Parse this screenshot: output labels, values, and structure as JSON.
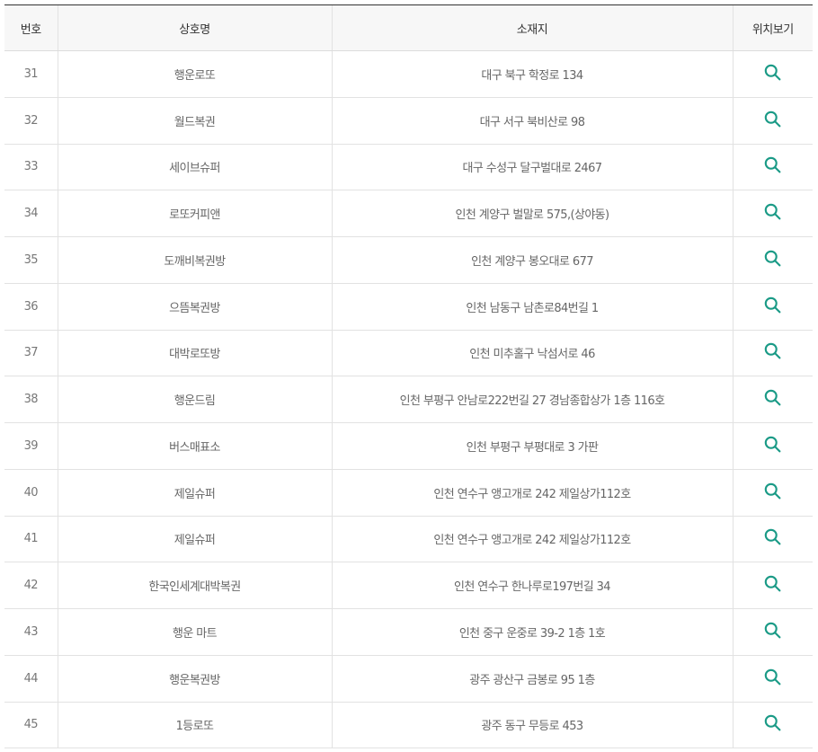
{
  "accent_color": "#1a9a86",
  "table": {
    "headers": [
      "번호",
      "상호명",
      "소재지",
      "위치보기"
    ],
    "rows": [
      {
        "no": "31",
        "name": "행운로또",
        "address": "대구 북구 학정로 134"
      },
      {
        "no": "32",
        "name": "월드복권",
        "address": "대구 서구 북비산로 98"
      },
      {
        "no": "33",
        "name": "세이브슈퍼",
        "address": "대구 수성구 달구벌대로 2467"
      },
      {
        "no": "34",
        "name": "로또커피앤",
        "address": "인천 계양구 벌말로 575,(상야동)"
      },
      {
        "no": "35",
        "name": "도깨비복권방",
        "address": "인천 계양구 봉오대로 677"
      },
      {
        "no": "36",
        "name": "으뜸복권방",
        "address": "인천 남동구 남촌로84번길 1"
      },
      {
        "no": "37",
        "name": "대박로또방",
        "address": "인천 미추홀구 낙섬서로 46"
      },
      {
        "no": "38",
        "name": "행운드림",
        "address": "인천 부평구 안남로222번길 27 경남종합상가 1층 116호"
      },
      {
        "no": "39",
        "name": "버스매표소",
        "address": "인천 부평구 부평대로 3 가판"
      },
      {
        "no": "40",
        "name": "제일슈퍼",
        "address": "인천 연수구 앵고개로 242 제일상가112호"
      },
      {
        "no": "41",
        "name": "제일슈퍼",
        "address": "인천 연수구 앵고개로 242 제일상가112호"
      },
      {
        "no": "42",
        "name": "한국인세계대박복권",
        "address": "인천 연수구 한나루로197번길 34"
      },
      {
        "no": "43",
        "name": "행운 마트",
        "address": "인천 중구 운중로 39-2 1층 1호"
      },
      {
        "no": "44",
        "name": "행운복권방",
        "address": "광주 광산구 금봉로 95 1층"
      },
      {
        "no": "45",
        "name": "1등로또",
        "address": "광주 동구 무등로 453"
      }
    ],
    "location_icon": "search-icon"
  }
}
